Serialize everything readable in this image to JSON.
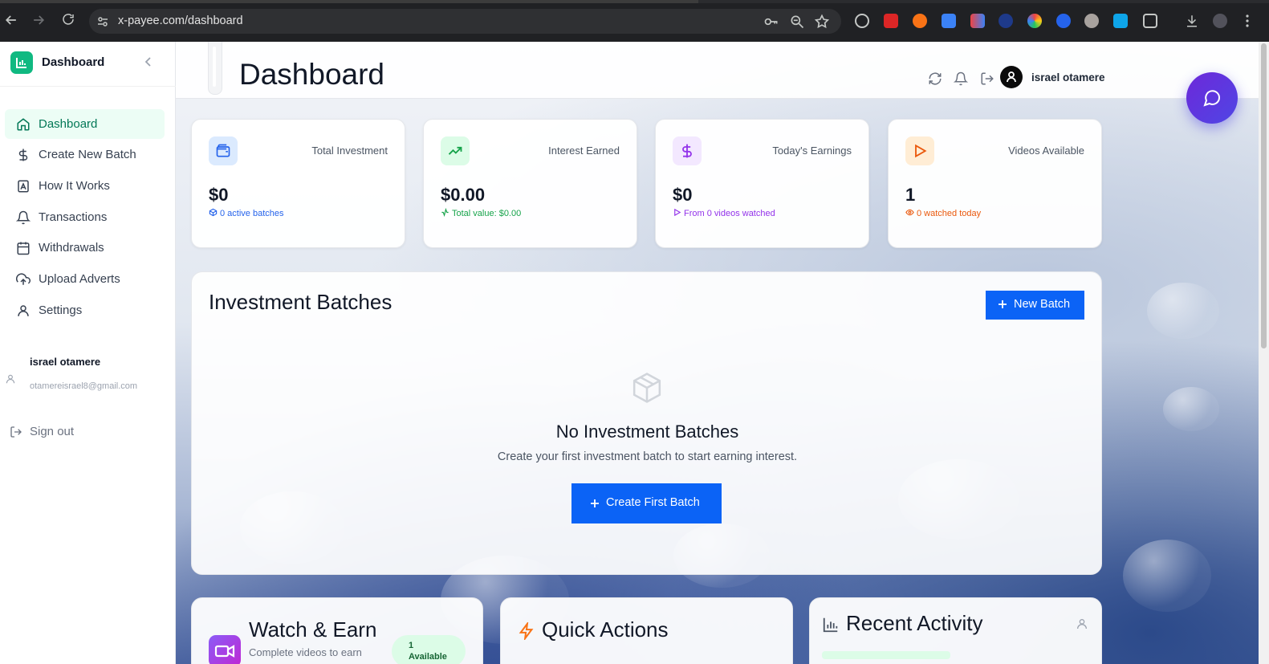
{
  "browser": {
    "url": "x-payee.com/dashboard"
  },
  "sidebar": {
    "brand_title": "Dashboard",
    "items": [
      {
        "label": "Dashboard",
        "icon": "home-icon",
        "active": true
      },
      {
        "label": "Create New Batch",
        "icon": "dollar-icon",
        "active": false
      },
      {
        "label": "How It Works",
        "icon": "book-icon",
        "active": false
      },
      {
        "label": "Transactions",
        "icon": "bell-icon",
        "active": false
      },
      {
        "label": "Withdrawals",
        "icon": "calendar-icon",
        "active": false
      },
      {
        "label": "Upload Adverts",
        "icon": "upload-cloud-icon",
        "active": false
      },
      {
        "label": "Settings",
        "icon": "user-icon",
        "active": false
      }
    ],
    "user": {
      "name": "israel otamere",
      "email": "otamereisrael8@gmail.com"
    },
    "sign_out_label": "Sign out"
  },
  "header": {
    "title": "Dashboard",
    "username": "israel otamere"
  },
  "stats": [
    {
      "label": "Total Investment",
      "value": "$0",
      "sub": "0 active batches",
      "icon": "wallet-icon",
      "color": "#2563eb",
      "bg": "#dbeafe"
    },
    {
      "label": "Interest Earned",
      "value": "$0.00",
      "sub": "Total value: $0.00",
      "icon": "trending-up-icon",
      "color": "#16a34a",
      "bg": "#dcfce7"
    },
    {
      "label": "Today's Earnings",
      "value": "$0",
      "sub": "From 0 videos watched",
      "icon": "dollar-icon",
      "color": "#9333ea",
      "bg": "#f3e8ff"
    },
    {
      "label": "Videos Available",
      "value": "1",
      "sub": "0 watched today",
      "icon": "play-icon",
      "color": "#ea580c",
      "bg": "#ffedd5"
    }
  ],
  "batches": {
    "title": "Investment Batches",
    "new_batch_label": "New Batch",
    "empty_title": "No Investment Batches",
    "empty_desc": "Create your first investment batch to start earning interest.",
    "create_first_label": "Create First Batch"
  },
  "bottom": {
    "watch_title": "Watch & Earn",
    "watch_sub": "Complete videos to earn",
    "available_count": "1",
    "available_label": "Available",
    "quick_title": "Quick Actions",
    "recent_title": "Recent Activity"
  },
  "colors": {
    "primary_blue": "#0b63f6",
    "brand_green": "#10b981",
    "active_nav_bg": "#ecfdf5",
    "active_nav_text": "#047857",
    "chat_gradient_start": "#6d28d9",
    "chat_gradient_end": "#4f46e5"
  }
}
